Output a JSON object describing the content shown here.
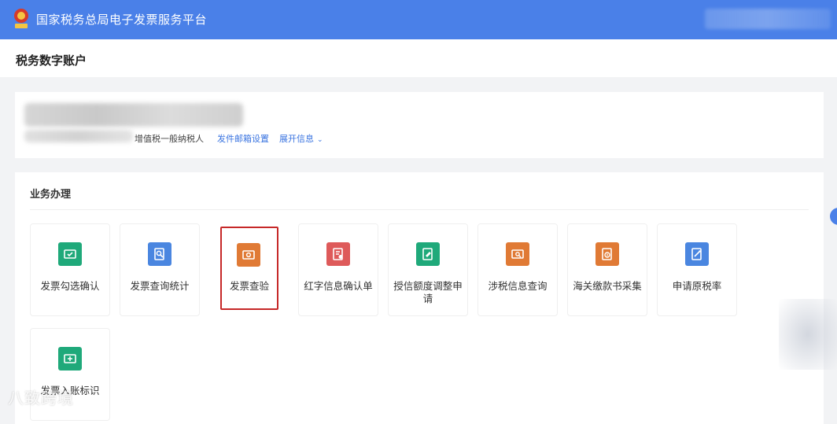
{
  "header": {
    "title": "国家税务总局电子发票服务平台",
    "emblem_icon": "national-tax-emblem-icon",
    "bar_color": "#4a80e8"
  },
  "page": {
    "title": "税务数字账户"
  },
  "account": {
    "taxpayer_type": "增值税一般纳税人",
    "email_setting_link": "发件邮箱设置",
    "expand_info_link": "展开信息",
    "link_color": "#3a74e0"
  },
  "business": {
    "section_title": "业务办理",
    "tiles": [
      {
        "label": "发票勾选确认",
        "icon": "ticket-check-icon",
        "color": "#1fa97a"
      },
      {
        "label": "发票查询统计",
        "icon": "document-search-icon",
        "color": "#4a86e0"
      },
      {
        "label": "发票查验",
        "icon": "invoice-verify-icon",
        "color": "#e07a35",
        "highlighted": true
      },
      {
        "label": "红字信息确认单",
        "icon": "red-letter-form-icon",
        "color": "#de5a5a"
      },
      {
        "label": "授信额度调整申请",
        "icon": "credit-adjust-icon",
        "color": "#1fa97a"
      },
      {
        "label": "涉税信息查询",
        "icon": "tax-info-search-icon",
        "color": "#e07a35"
      },
      {
        "label": "海关缴款书采集",
        "icon": "customs-payment-icon",
        "color": "#e07a35"
      },
      {
        "label": "申请原税率",
        "icon": "original-rate-icon",
        "color": "#4a86e0"
      },
      {
        "label": "发票入账标识",
        "icon": "invoice-entry-mark-icon",
        "color": "#1fa97a"
      }
    ]
  },
  "watermark": {
    "text": "八致跨境"
  }
}
